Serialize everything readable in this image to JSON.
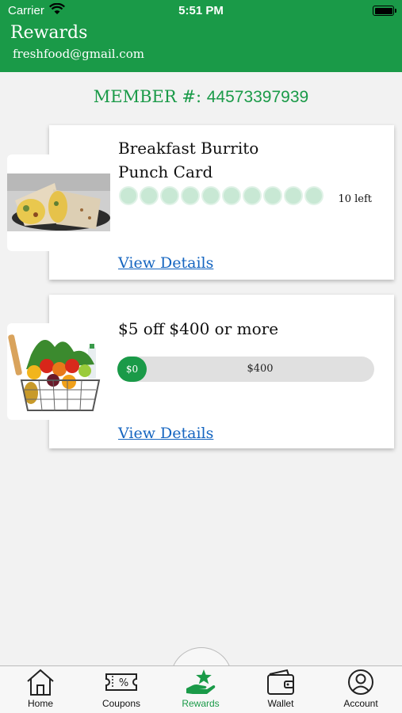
{
  "status": {
    "carrier": "Carrier",
    "time": "5:51 PM"
  },
  "header": {
    "title": "Rewards",
    "email": "freshfood@gmail.com"
  },
  "member": {
    "label": "MEMBER #:",
    "number": "44573397939"
  },
  "cards": [
    {
      "title_line1": "Breakfast Burrito",
      "title_line2": "Punch Card",
      "punches_total": 10,
      "punches_done": 0,
      "left_label": "10 left",
      "details_label": "View Details"
    },
    {
      "title": "$5 off $400 or more",
      "progress_current": "$0",
      "progress_goal": "$400",
      "progress_fraction": 0,
      "details_label": "View Details"
    }
  ],
  "tabs": [
    {
      "label": "Home",
      "icon": "home-icon"
    },
    {
      "label": "Coupons",
      "icon": "coupon-icon"
    },
    {
      "label": "Rewards",
      "icon": "rewards-icon",
      "active": true
    },
    {
      "label": "Wallet",
      "icon": "wallet-icon"
    },
    {
      "label": "Account",
      "icon": "account-icon"
    }
  ],
  "colors": {
    "brand": "#1a9a48",
    "link": "#1565c0",
    "punch": "#c8e8d4"
  }
}
